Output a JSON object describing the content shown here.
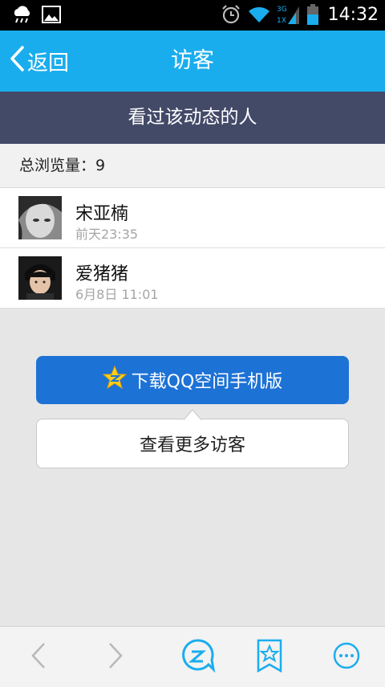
{
  "status_bar": {
    "time": "14:32",
    "network_top": "3G",
    "network_bottom": "1X",
    "icons": [
      "weather-icon",
      "image-icon",
      "alarm-icon",
      "wifi-icon",
      "signal-icon",
      "battery-icon"
    ]
  },
  "header": {
    "back_label": "返回",
    "title": "访客"
  },
  "section": {
    "title": "看过该动态的人"
  },
  "summary": {
    "text": "总浏览量：9"
  },
  "visitors": [
    {
      "name": "宋亚楠",
      "time": "前天23:35",
      "avatar": "avatar-icon"
    },
    {
      "name": "爱猪猪",
      "time": "6月8日 11:01",
      "avatar": "avatar-icon"
    }
  ],
  "actions": {
    "download_label": "下载QQ空间手机版",
    "more_visitors_label": "查看更多访客"
  },
  "toolbar": {
    "items": [
      "back-arrow-icon",
      "forward-arrow-icon",
      "qzone-home-icon",
      "bookmark-star-icon",
      "menu-icon"
    ]
  },
  "colors": {
    "header_bg": "#1aadee",
    "section_bg": "#434a68",
    "download_bg": "#1d72d6"
  }
}
